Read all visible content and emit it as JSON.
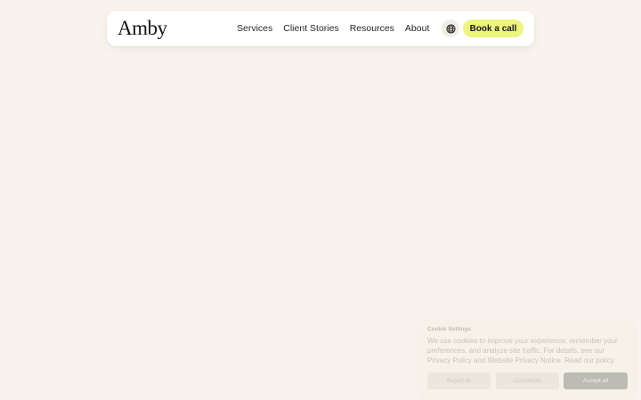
{
  "header": {
    "logo": "Amby",
    "nav": [
      "Services",
      "Client Stories",
      "Resources",
      "About"
    ],
    "language_icon": "globe-icon",
    "cta_label": "Book a call"
  },
  "cookie_banner": {
    "title": "Cookie Settings",
    "text": "We use cookies to improve your experience, remember your preferences, and analyze site traffic. For details, see our Privacy Policy and Website Privacy Notice. Read our policy.",
    "reject_label": "Reject all",
    "customize_label": "Customize",
    "accept_label": "Accept all"
  },
  "colors": {
    "background": "#f8f3ec",
    "cta": "#eef57c",
    "accept": "#bdbcb4"
  }
}
